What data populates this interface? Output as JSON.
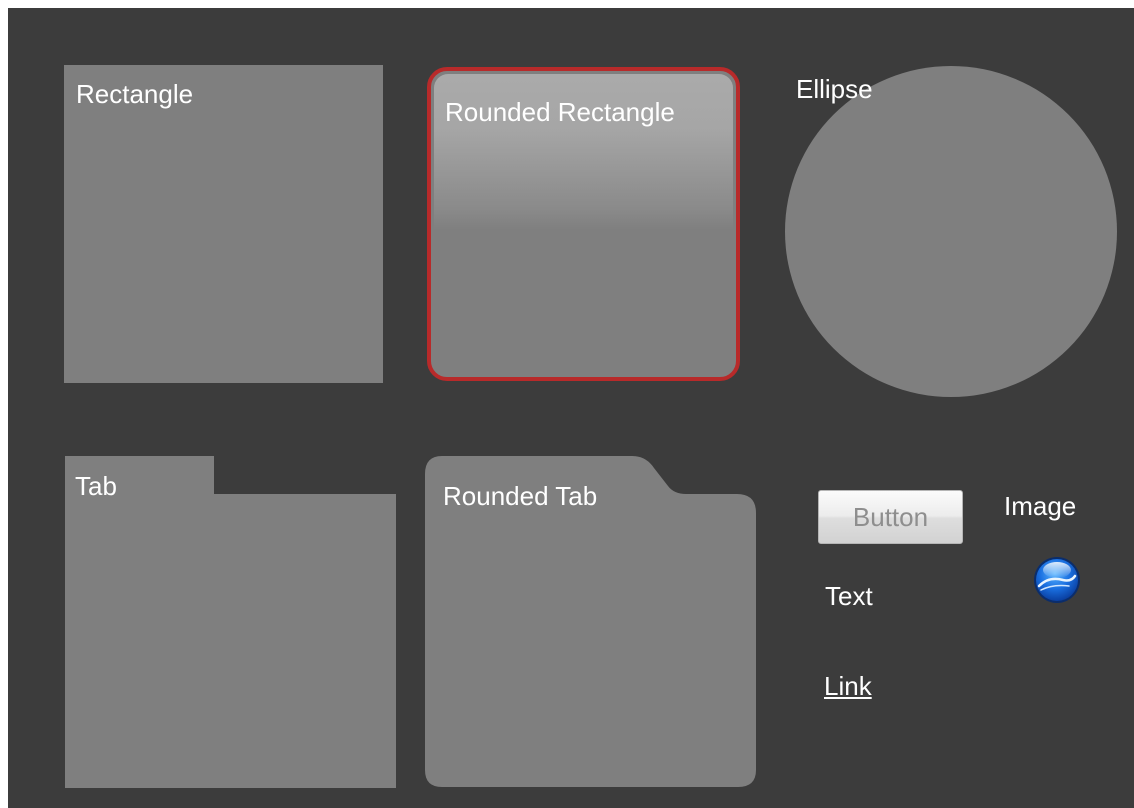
{
  "shapes": {
    "rectangle_label": "Rectangle",
    "rounded_rectangle_label": "Rounded Rectangle",
    "ellipse_label": "Ellipse",
    "tab_label": "Tab",
    "rounded_tab_label": "Rounded Tab"
  },
  "controls": {
    "button_label": "Button",
    "text_label": "Text",
    "link_label": "Link",
    "image_label": "Image",
    "image_icon": "globe-orb-icon"
  },
  "colors": {
    "background": "#3c3c3c",
    "shape_fill": "#7f7f7f",
    "selection_border": "#b82a2a",
    "label_text": "#ffffff"
  }
}
